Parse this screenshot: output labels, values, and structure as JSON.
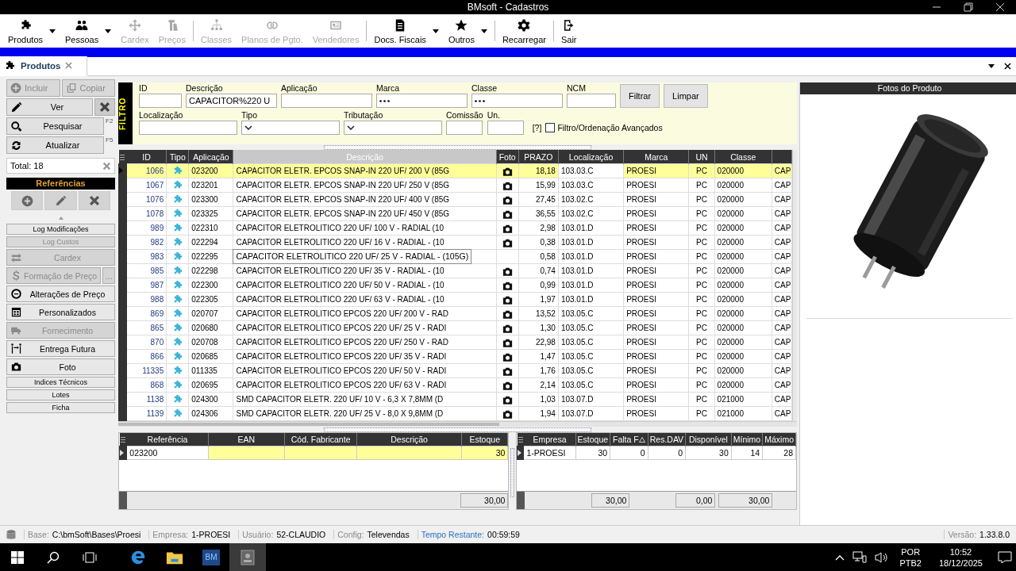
{
  "window": {
    "title": "BMsoft - Cadastros"
  },
  "toolbar": [
    {
      "label": "Produtos",
      "disabled": false,
      "dropdown": true
    },
    {
      "label": "Pessoas",
      "disabled": false,
      "dropdown": true
    },
    {
      "label": "Cardex",
      "disabled": true,
      "dropdown": false
    },
    {
      "label": "Preços",
      "disabled": true,
      "dropdown": false
    },
    {
      "kind": "separator"
    },
    {
      "label": "Classes",
      "disabled": true,
      "dropdown": false
    },
    {
      "label": "Planos de Pgto.",
      "disabled": true,
      "dropdown": false
    },
    {
      "label": "Vendedores",
      "disabled": true,
      "dropdown": false
    },
    {
      "kind": "separator"
    },
    {
      "label": "Docs. Fiscais",
      "disabled": false,
      "dropdown": true
    },
    {
      "label": "Outros",
      "disabled": false,
      "dropdown": true
    },
    {
      "kind": "separator"
    },
    {
      "label": "Recarregar",
      "disabled": false,
      "dropdown": false
    },
    {
      "kind": "separator"
    },
    {
      "label": "Sair",
      "disabled": false,
      "dropdown": false
    }
  ],
  "tabs": [
    {
      "label": "Produtos",
      "selected": true
    }
  ],
  "side": {
    "include": {
      "label": "Incluir",
      "disabled": true
    },
    "copy": {
      "label": "Copiar",
      "disabled": true
    },
    "view": {
      "label": "Ver"
    },
    "search": {
      "label": "Pesquisar",
      "key": "F2"
    },
    "refresh": {
      "label": "Atualizar",
      "key": "F5"
    },
    "total": "Total: 18",
    "references_title": "Referências",
    "links": [
      {
        "label": "Log Modificações",
        "kind": "small",
        "disabled": false
      },
      {
        "label": "Log Custos",
        "kind": "small",
        "disabled": true
      },
      {
        "label": "Cardex",
        "kind": "large",
        "disabled": true
      },
      {
        "label": "Formação de Preço",
        "kind": "large",
        "disabled": true,
        "extra": "..."
      },
      {
        "label": "Alterações de Preço",
        "kind": "large",
        "disabled": false
      },
      {
        "label": "Personalizados",
        "kind": "large",
        "disabled": false
      },
      {
        "label": "Fornecimento",
        "kind": "large",
        "disabled": true
      },
      {
        "label": "Entrega Futura",
        "kind": "large",
        "disabled": false
      },
      {
        "label": "Foto",
        "kind": "large",
        "disabled": false
      },
      {
        "label": "Indices Técnicos",
        "kind": "small",
        "disabled": false
      },
      {
        "label": "Lotes",
        "kind": "small",
        "disabled": false
      },
      {
        "label": "Ficha",
        "kind": "small",
        "disabled": false
      }
    ]
  },
  "filter": {
    "title": "FILTRO",
    "row1": [
      {
        "label": "ID",
        "kind": "text"
      },
      {
        "label": "Descrição",
        "kind": "text",
        "value": "CAPACITOR%220 U"
      },
      {
        "label": "Aplicação",
        "kind": "text"
      },
      {
        "label": "Marca",
        "kind": "lookup"
      },
      {
        "label": "Classe",
        "kind": "lookup"
      },
      {
        "label": "NCM",
        "kind": "text"
      }
    ],
    "buttons": [
      "Filtrar",
      "Limpar"
    ],
    "row2": [
      {
        "label": "Localização",
        "kind": "text"
      },
      {
        "label": "Tipo",
        "kind": "select"
      },
      {
        "label": "Tributação",
        "kind": "select"
      },
      {
        "label": "Comissão",
        "kind": "text"
      },
      {
        "label": "Un.",
        "kind": "text"
      }
    ],
    "help": "[?]",
    "advanced": {
      "label": "Filtro/Ordenação Avançados",
      "checked": false
    }
  },
  "table": {
    "columns": [
      {
        "label": "ID",
        "highlighted": false
      },
      {
        "label": "Tipo",
        "highlighted": false
      },
      {
        "label": "Aplicação",
        "highlighted": false
      },
      {
        "label": "Descrição",
        "highlighted": true
      },
      {
        "label": "Foto",
        "highlighted": false
      },
      {
        "label": "PRAZO",
        "highlighted": false
      },
      {
        "label": "Localização",
        "highlighted": false
      },
      {
        "label": "Marca",
        "highlighted": false
      },
      {
        "label": "UN",
        "highlighted": false
      },
      {
        "label": "Classe",
        "highlighted": false
      }
    ],
    "rows": [
      {
        "id": "1066",
        "application": "023200",
        "description": "CAPACITOR ELETR. EPCOS SNAP-IN 220 UF/ 200 V (85G",
        "photo": true,
        "prazo": "18,18",
        "location": "103.03.C",
        "brand": "PROESI",
        "unit": "PC",
        "class": "020000",
        "column_11": "CAP",
        "selected": true
      },
      {
        "id": "1067",
        "application": "023201",
        "description": "CAPACITOR ELETR. EPCOS SNAP-IN 220 UF/ 250 V (85G",
        "photo": true,
        "prazo": "15,99",
        "location": "103.03.C",
        "brand": "PROESI",
        "unit": "PC",
        "class": "020000",
        "column_11": "CAP",
        "selected": false
      },
      {
        "id": "1076",
        "application": "023300",
        "description": "CAPACITOR ELETR. EPCOS SNAP-IN 220 UF/ 400 V (85G",
        "photo": true,
        "prazo": "27,45",
        "location": "103.02.C",
        "brand": "PROESI",
        "unit": "PC",
        "class": "020000",
        "column_11": "CAP",
        "selected": false
      },
      {
        "id": "1078",
        "application": "023325",
        "description": "CAPACITOR ELETR. EPCOS SNAP-IN 220 UF/ 450 V (85G",
        "photo": true,
        "prazo": "36,55",
        "location": "103.02.C",
        "brand": "PROESI",
        "unit": "PC",
        "class": "020000",
        "column_11": "CAP",
        "selected": false
      },
      {
        "id": "989",
        "application": "022310",
        "description": "CAPACITOR ELETROLITICO 220 UF/ 100 V - RADIAL (10",
        "photo": true,
        "prazo": "2,98",
        "location": "103.01.D",
        "brand": "PROESI",
        "unit": "PC",
        "class": "020000",
        "column_11": "CAP",
        "selected": false
      },
      {
        "id": "982",
        "application": "022294",
        "description": "CAPACITOR ELETROLITICO 220 UF/ 16 V - RADIAL - (10",
        "photo": true,
        "prazo": "0,38",
        "location": "103.01.D",
        "brand": "PROESI",
        "unit": "PC",
        "class": "020000",
        "column_11": "CAP",
        "selected": false
      },
      {
        "id": "983",
        "application": "022295",
        "description": "CAPACITOR ELETROLITICO 220 UF/ 25 V - RADIAL - (105G)",
        "hint": true,
        "photo": false,
        "prazo": "0,58",
        "location": "103.01.D",
        "brand": "PROESI",
        "unit": "PC",
        "class": "020000",
        "column_11": "CAP",
        "selected": false
      },
      {
        "id": "985",
        "application": "022298",
        "description": "CAPACITOR ELETROLITICO 220 UF/ 35 V - RADIAL - (10",
        "photo": true,
        "prazo": "0,74",
        "location": "103.01.D",
        "brand": "PROESI",
        "unit": "PC",
        "class": "020000",
        "column_11": "CAP",
        "selected": false
      },
      {
        "id": "987",
        "application": "022300",
        "description": "CAPACITOR ELETROLITICO 220 UF/ 50 V - RADIAL - (10",
        "photo": true,
        "prazo": "0,99",
        "location": "103.01.D",
        "brand": "PROESI",
        "unit": "PC",
        "class": "020000",
        "column_11": "CAP",
        "selected": false
      },
      {
        "id": "988",
        "application": "022305",
        "description": "CAPACITOR ELETROLITICO 220 UF/ 63 V - RADIAL - (10",
        "photo": true,
        "prazo": "1,97",
        "location": "103.01.D",
        "brand": "PROESI",
        "unit": "PC",
        "class": "020000",
        "column_11": "CAP",
        "selected": false
      },
      {
        "id": "869",
        "application": "020707",
        "description": "CAPACITOR ELETROLITICO EPCOS 220 UF/ 200 V - RAD",
        "photo": true,
        "prazo": "13,52",
        "location": "103.05.C",
        "brand": "PROESI",
        "unit": "PC",
        "class": "020000",
        "column_11": "CAP",
        "selected": false
      },
      {
        "id": "865",
        "application": "020680",
        "description": "CAPACITOR ELETROLITICO EPCOS 220 UF/ 25 V - RADI",
        "photo": true,
        "prazo": "1,30",
        "location": "103.05.C",
        "brand": "PROESI",
        "unit": "PC",
        "class": "020000",
        "column_11": "CAP",
        "selected": false
      },
      {
        "id": "870",
        "application": "020708",
        "description": "CAPACITOR ELETROLITICO EPCOS 220 UF/ 250 V - RAD",
        "photo": true,
        "prazo": "22,98",
        "location": "103.05.C",
        "brand": "PROESI",
        "unit": "PC",
        "class": "020000",
        "column_11": "CAP",
        "selected": false
      },
      {
        "id": "866",
        "application": "020685",
        "description": "CAPACITOR ELETROLITICO EPCOS 220 UF/ 35 V - RADI",
        "photo": true,
        "prazo": "1,47",
        "location": "103.05.C",
        "brand": "PROESI",
        "unit": "PC",
        "class": "020000",
        "column_11": "CAP",
        "selected": false
      },
      {
        "id": "11335",
        "application": "011335",
        "description": "CAPACITOR ELETROLITICO EPCOS 220 UF/ 50 V - RADI",
        "photo": true,
        "prazo": "1,76",
        "location": "103.05.C",
        "brand": "PROESI",
        "unit": "PC",
        "class": "020000",
        "column_11": "CAP",
        "selected": false
      },
      {
        "id": "868",
        "application": "020695",
        "description": "CAPACITOR ELETROLITICO EPCOS 220 UF/ 63 V - RADI",
        "photo": true,
        "prazo": "2,14",
        "location": "103.05.C",
        "brand": "PROESI",
        "unit": "PC",
        "class": "020000",
        "column_11": "CAP",
        "selected": false
      },
      {
        "id": "1138",
        "application": "024300",
        "description": "SMD CAPACITOR ELETR. 220 UF/ 10 V - 6,3 X 7,8MM (D",
        "photo": true,
        "prazo": "1,03",
        "location": "103.07.D",
        "brand": "PROESI",
        "unit": "PC",
        "class": "021000",
        "column_11": "CAP",
        "selected": false
      },
      {
        "id": "1139",
        "application": "024306",
        "description": "SMD CAPACITOR ELETR. 220 UF/ 25 V - 8,0 X 9,8MM (D",
        "photo": true,
        "prazo": "1,94",
        "location": "103.07.D",
        "brand": "PROESI",
        "unit": "PC",
        "class": "021000",
        "column_11": "CAP",
        "selected": false
      }
    ]
  },
  "photo_panel": {
    "title": "Fotos do Produto"
  },
  "references": {
    "columns": [
      "Referência",
      "EAN",
      "Cód. Fabricante",
      "Descrição",
      "Estoque"
    ],
    "rows": [
      {
        "reference": "023200",
        "stock": "30",
        "selected": true
      }
    ],
    "footer_stock": "30,00"
  },
  "stock": {
    "columns": [
      {
        "label": "Empresa",
        "sorted": false
      },
      {
        "label": "Estoque",
        "sorted": false
      },
      {
        "label": "Falta F",
        "sorted": true
      },
      {
        "label": "Res.DAV",
        "sorted": false
      },
      {
        "label": "Disponível",
        "sorted": false
      },
      {
        "label": "Mínimo",
        "sorted": false
      },
      {
        "label": "Máximo",
        "sorted": false
      }
    ],
    "rows": [
      {
        "company": "1-PROESI",
        "stock": "30",
        "shortage": "0",
        "reserved": "0",
        "available": "30",
        "minimum": "14",
        "maximum": "28",
        "selected": true
      }
    ],
    "footer": {
      "stock": "30,00",
      "reserved": "0,00",
      "available": "30,00"
    }
  },
  "status_bar": {
    "items": [
      {
        "label": "Base:",
        "value": "C:\\bmSoft\\Bases\\Proesi",
        "highlight": false
      },
      {
        "label": "Empresa:",
        "value": "1-PROESI",
        "highlight": false
      },
      {
        "label": "Usuário:",
        "value": "52-CLAUDIO",
        "highlight": false
      },
      {
        "label": "Config:",
        "value": "Televendas",
        "highlight": false
      },
      {
        "label": "Tempo Restante:",
        "value": "00:59:59",
        "highlight": true
      }
    ],
    "version": {
      "label": "Versão:",
      "value": "1.33.8.0"
    }
  },
  "taskbar": {
    "apps": [
      {
        "selected": false
      },
      {
        "selected": false
      },
      {
        "label": "BM",
        "selected": false
      },
      {
        "selected": true
      }
    ],
    "language": "POR",
    "layout": "PTB2",
    "time": "10:52",
    "date": "18/12/2025"
  }
}
